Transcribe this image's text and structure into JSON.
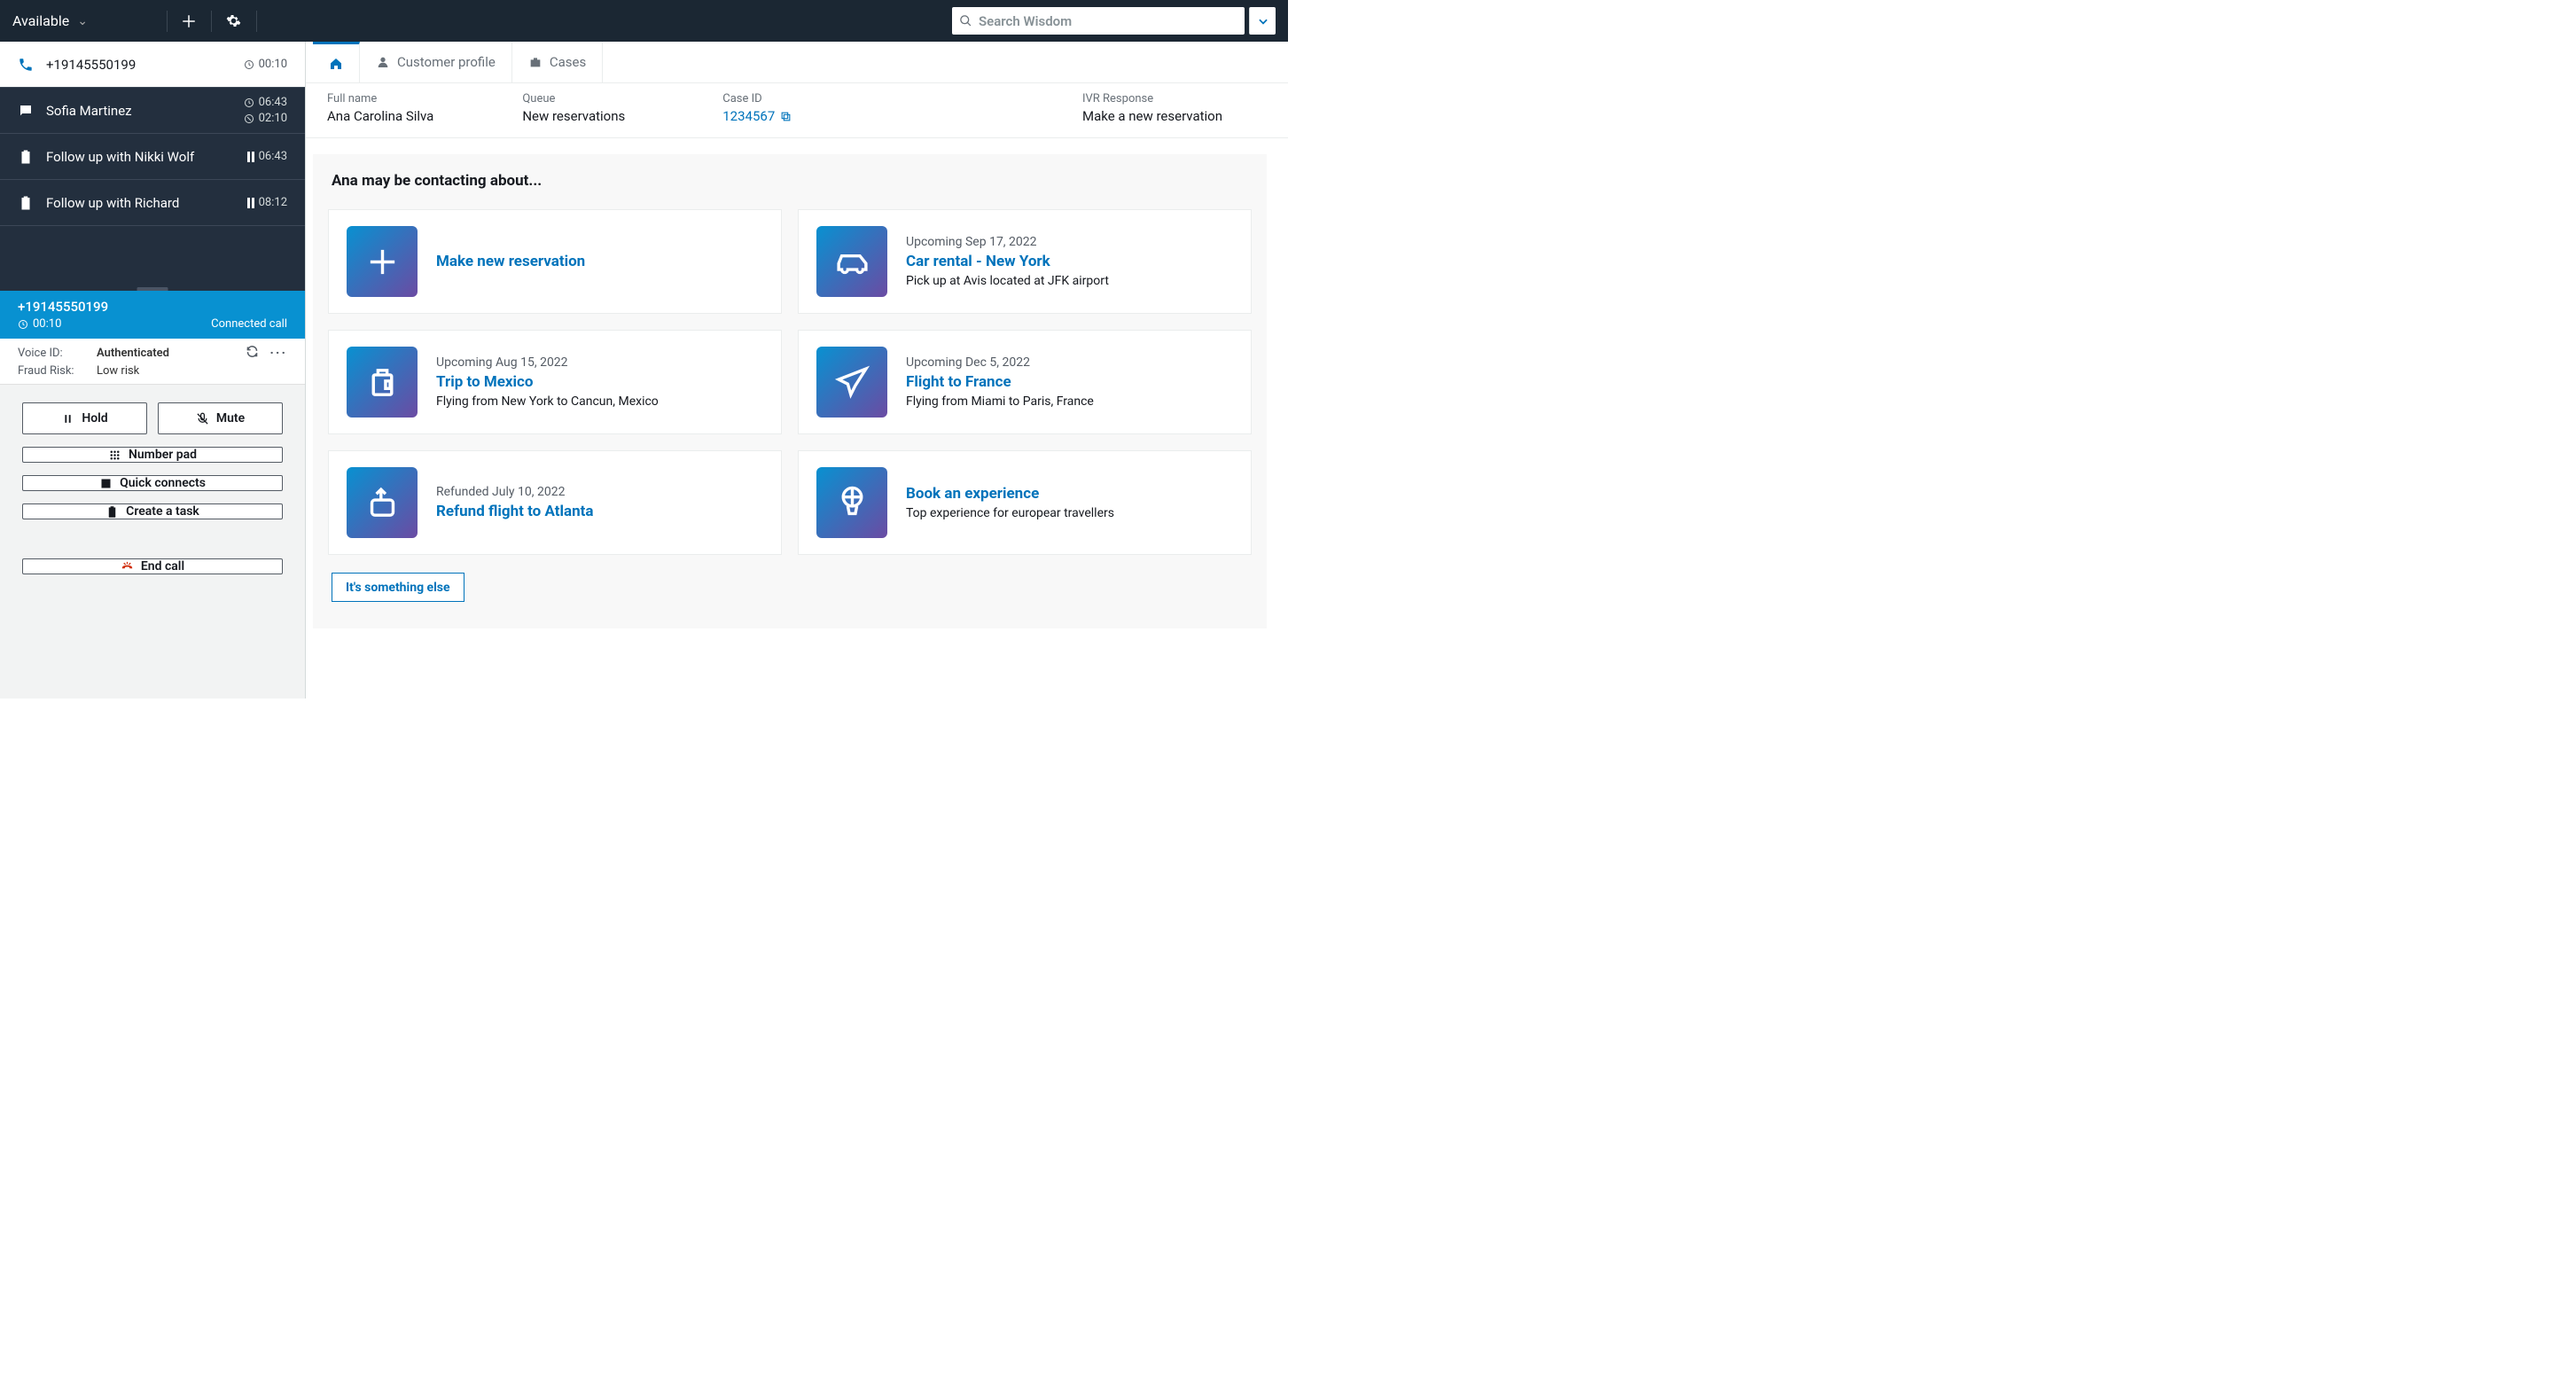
{
  "topbar": {
    "status": "Available",
    "search_placeholder": "Search Wisdom"
  },
  "contacts": [
    {
      "label": "+19145550199",
      "t1": "00:10"
    },
    {
      "label": "Sofia Martinez",
      "t1": "06:43",
      "t2": "02:10"
    },
    {
      "label": "Follow up with Nikki Wolf",
      "t1": "06:43"
    },
    {
      "label": "Follow up with Richard",
      "t1": "08:12"
    }
  ],
  "connected": {
    "number": "+19145550199",
    "timer": "00:10",
    "status": "Connected call"
  },
  "voiceid": {
    "label1": "Voice ID:",
    "val1": "Authenticated",
    "label2": "Fraud Risk:",
    "val2": "Low risk"
  },
  "controls": {
    "hold": "Hold",
    "mute": "Mute",
    "numberpad": "Number pad",
    "quickconnects": "Quick connects",
    "createtask": "Create a task",
    "endcall": "End call"
  },
  "tabs": {
    "profile": "Customer profile",
    "cases": "Cases"
  },
  "customer": {
    "full_name_label": "Full name",
    "full_name": "Ana Carolina Silva",
    "queue_label": "Queue",
    "queue": "New reservations",
    "case_label": "Case ID",
    "case": "1234567",
    "ivr_label": "IVR Response",
    "ivr": "Make a new reservation"
  },
  "suggestions": {
    "title": "Ana may be contacting about...",
    "something_else": "It's something else",
    "cards": [
      {
        "pre": "",
        "title": "Make new reservation",
        "desc": ""
      },
      {
        "pre": "Upcoming Sep 17, 2022",
        "title": "Car rental - New York",
        "desc": "Pick up at Avis located at JFK airport"
      },
      {
        "pre": "Upcoming Aug 15, 2022",
        "title": "Trip to Mexico",
        "desc": "Flying from New York to Cancun, Mexico"
      },
      {
        "pre": "Upcoming Dec 5, 2022",
        "title": "Flight to France",
        "desc": "Flying from Miami to Paris, France"
      },
      {
        "pre": "Refunded July 10, 2022",
        "title": "Refund flight to Atlanta",
        "desc": ""
      },
      {
        "pre": "",
        "title": "Book an experience",
        "desc": "Top experience for europear travellers"
      }
    ]
  }
}
